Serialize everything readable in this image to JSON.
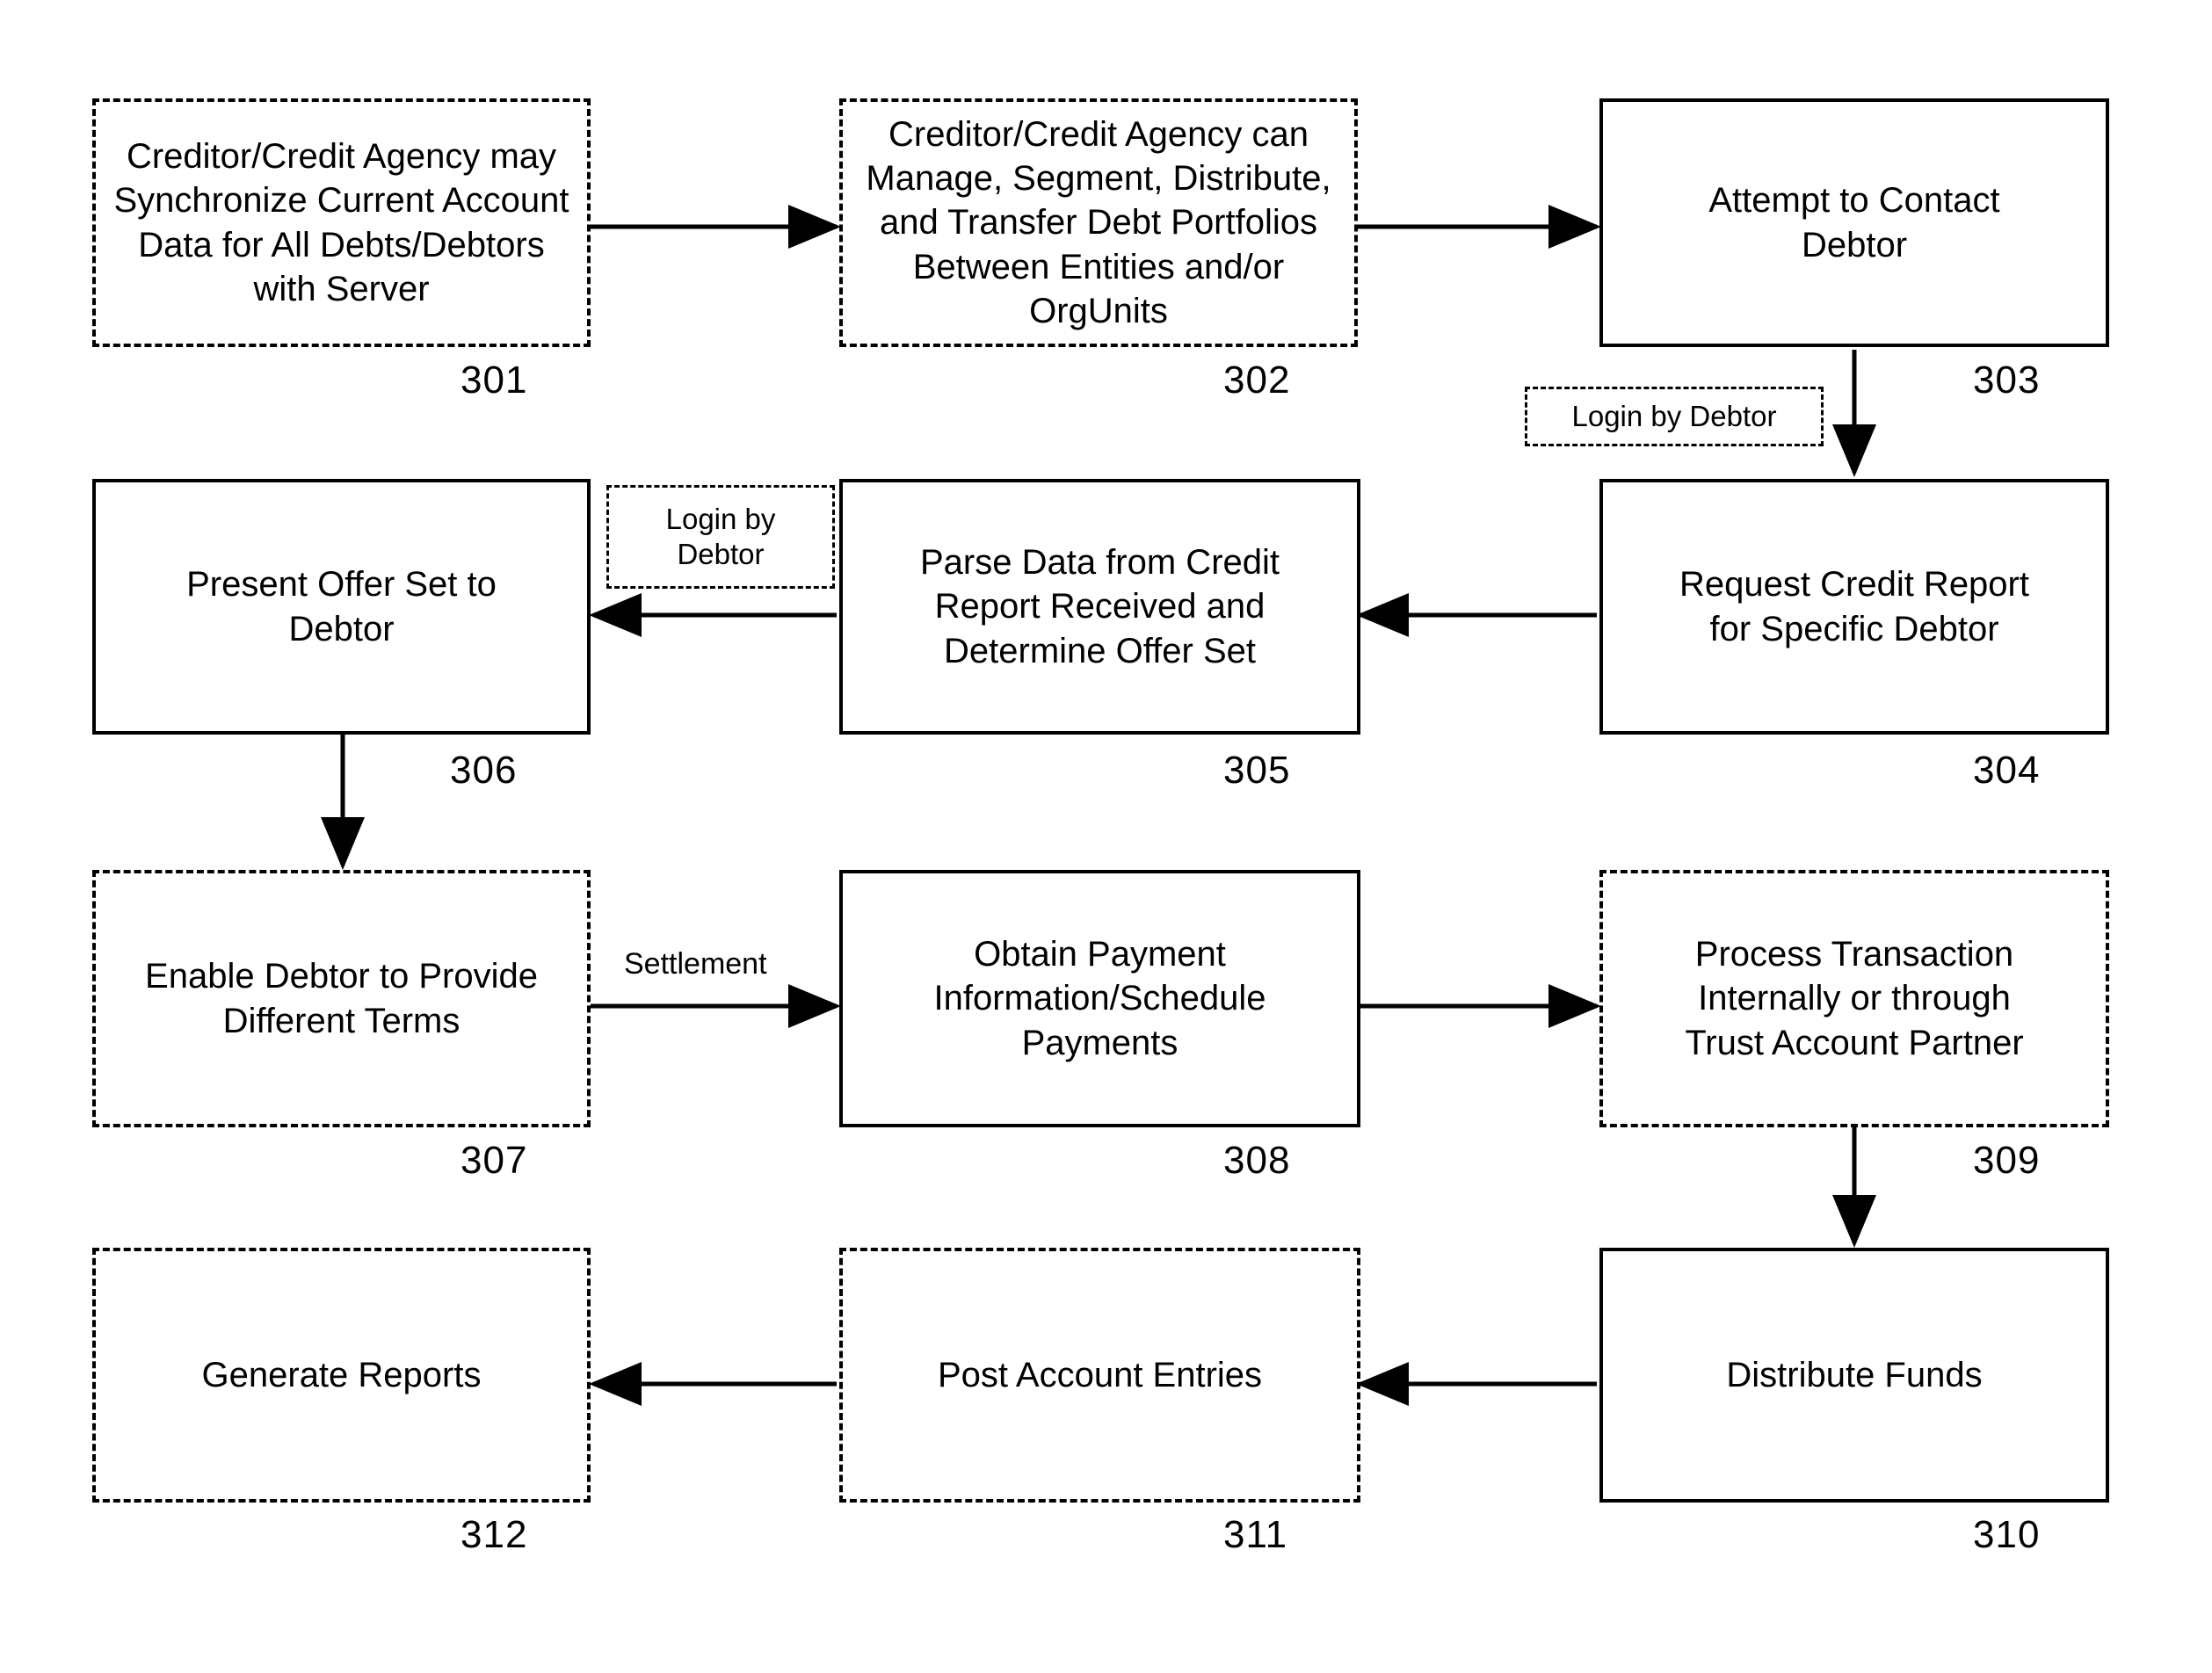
{
  "figure": {
    "type": "process-flowchart",
    "background": "#ffffff",
    "line_color": "#000000"
  },
  "nodes": [
    {
      "id": "n301",
      "ref": "301",
      "border": "dashed",
      "text": "Creditor/Credit Agency may\nSynchronize Current Account\nData for All Debts/Debtors\nwith Server"
    },
    {
      "id": "n302",
      "ref": "302",
      "border": "dashed",
      "text": "Creditor/Credit Agency can\nManage, Segment, Distribute,\nand Transfer Debt Portfolios\nBetween Entities and/or\nOrgUnits"
    },
    {
      "id": "n303",
      "ref": "303",
      "border": "solid",
      "text": "Attempt to Contact\nDebtor"
    },
    {
      "id": "n304",
      "ref": "304",
      "border": "solid",
      "text": "Request Credit Report\nfor Specific Debtor"
    },
    {
      "id": "n305",
      "ref": "305",
      "border": "solid",
      "text": "Parse Data from Credit\nReport Received and\nDetermine Offer Set"
    },
    {
      "id": "n306",
      "ref": "306",
      "border": "solid",
      "text": "Present Offer Set to\nDebtor"
    },
    {
      "id": "n307",
      "ref": "307",
      "border": "dashed",
      "text": "Enable Debtor to Provide\nDifferent Terms"
    },
    {
      "id": "n308",
      "ref": "308",
      "border": "solid",
      "text": "Obtain Payment\nInformation/Schedule\nPayments"
    },
    {
      "id": "n309",
      "ref": "309",
      "border": "dashed",
      "text": "Process Transaction\nInternally or through\nTrust Account Partner"
    },
    {
      "id": "n310",
      "ref": "310",
      "border": "solid",
      "text": "Distribute Funds"
    },
    {
      "id": "n311",
      "ref": "311",
      "border": "dashed",
      "text": "Post Account Entries"
    },
    {
      "id": "n312",
      "ref": "312",
      "border": "dashed",
      "text": "Generate Reports"
    }
  ],
  "annotations": {
    "login_by_debtor_top": "Login by Debtor",
    "login_by_debtor_mid": "Login by\nDebtor"
  },
  "edge_labels": {
    "settlement": "Settlement"
  },
  "ref_labels": {
    "r301": "301",
    "r302": "302",
    "r303": "303",
    "r304": "304",
    "r305": "305",
    "r306": "306",
    "r307": "307",
    "r308": "308",
    "r309": "309",
    "r310": "310",
    "r311": "311",
    "r312": "312"
  }
}
